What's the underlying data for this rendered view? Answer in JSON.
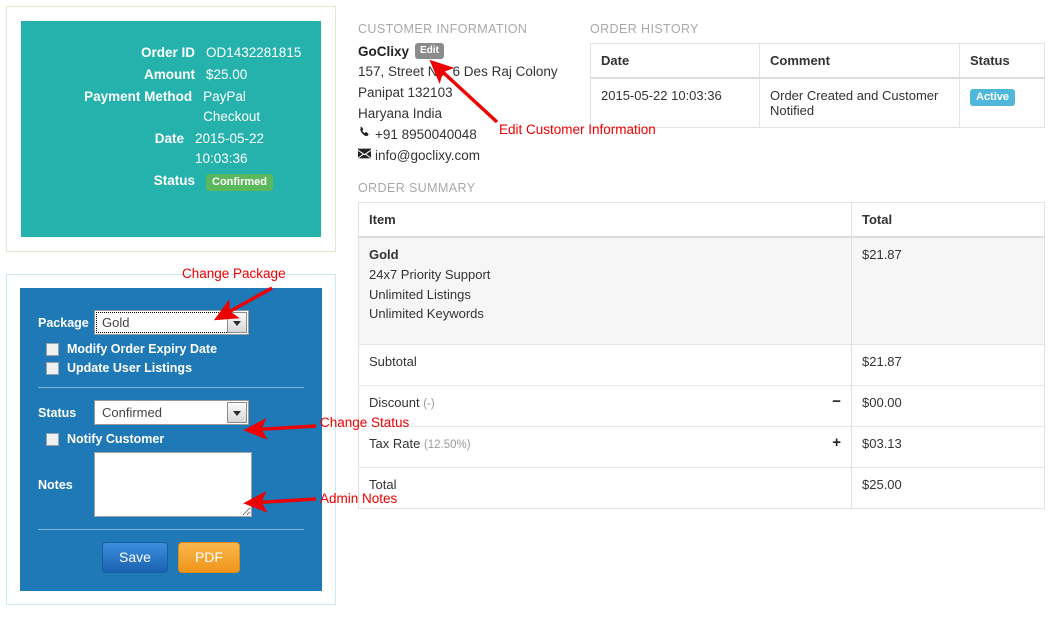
{
  "order_card": {
    "rows": [
      {
        "label": "Order ID",
        "value": "OD1432281815"
      },
      {
        "label": "Amount",
        "value": "$25.00"
      },
      {
        "label": "Payment Method",
        "value": "PayPal Checkout"
      },
      {
        "label": "Date",
        "value": "2015-05-22 10:03:36"
      }
    ],
    "status_label": "Status",
    "status_badge": "Confirmed",
    "badge_color": "#5cb85c",
    "card_color": "#25b2ac"
  },
  "order_form": {
    "package_label": "Package",
    "package_value": "Gold",
    "package_options": [
      "Gold"
    ],
    "checkbox_modify_expiry": "Modify Order Expiry Date",
    "checkbox_update_listings": "Update User Listings",
    "status_label": "Status",
    "status_value": "Confirmed",
    "status_options": [
      "Confirmed"
    ],
    "checkbox_notify": "Notify Customer",
    "notes_label": "Notes",
    "notes_value": "",
    "save_label": "Save",
    "pdf_label": "PDF",
    "panel_color": "#2079b7"
  },
  "customer": {
    "section_title": "CUSTOMER INFORMATION",
    "name": "GoClixy",
    "edit_label": "Edit",
    "address_line1": "157, Street No. 6 Des Raj Colony",
    "address_line2": "Panipat 132103",
    "address_line3": "Haryana India",
    "phone_icon": "phone-icon",
    "phone": "+91 8950040048",
    "email_icon": "envelope-icon",
    "email": "info@goclixy.com"
  },
  "order_history": {
    "section_title": "ORDER HISTORY",
    "columns": [
      "Date",
      "Comment",
      "Status"
    ],
    "rows": [
      {
        "date": "2015-05-22 10:03:36",
        "comment": "Order Created and Customer Notified",
        "status": "Active"
      }
    ],
    "status_badge_color": "#4fb8da"
  },
  "order_summary": {
    "section_title": "ORDER SUMMARY",
    "columns": [
      "Item",
      "Total"
    ],
    "item": {
      "name": "Gold",
      "features": [
        "24x7 Priority Support",
        "Unlimited Listings",
        "Unlimited Keywords"
      ],
      "total": "$21.87"
    },
    "subtotal_label": "Subtotal",
    "subtotal_value": "$21.87",
    "discount_label": "Discount",
    "discount_note": "(-)",
    "discount_sign": "−",
    "discount_value": "$00.00",
    "tax_label": "Tax Rate",
    "tax_note": "(12.50%)",
    "tax_sign": "+",
    "tax_value": "$03.13",
    "total_label": "Total",
    "total_value": "$25.00"
  },
  "annotations": {
    "change_package": "Change Package",
    "edit_customer": "Edit Customer Information",
    "change_status": "Change Status",
    "admin_notes": "Admin Notes",
    "color": "#ee0000"
  }
}
